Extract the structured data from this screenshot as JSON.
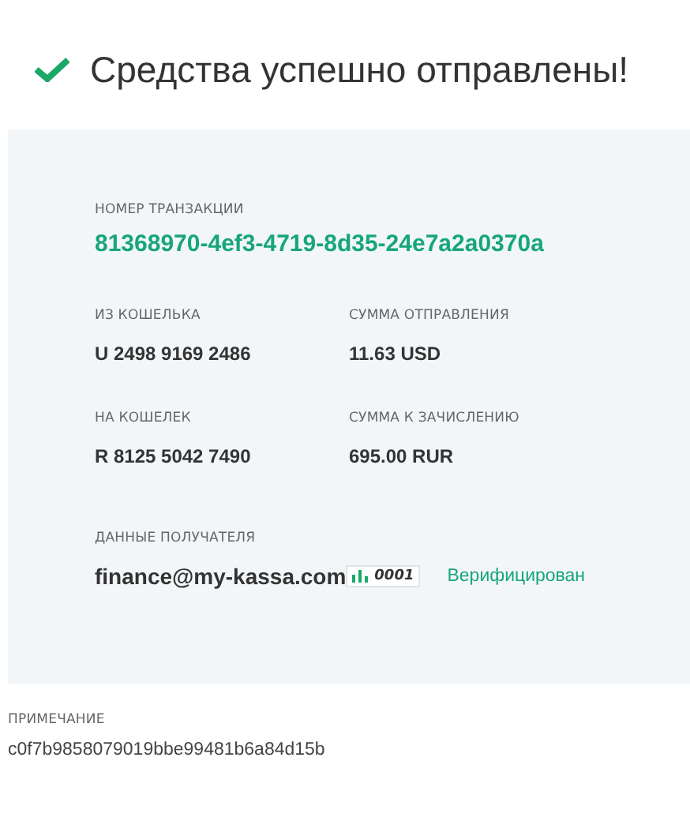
{
  "title": "Средства успешно отправлены!",
  "transaction": {
    "label": "НОМЕР ТРАНЗАКЦИИ",
    "value": "81368970-4ef3-4719-8d35-24e7a2a0370a"
  },
  "fields": [
    {
      "label": "ИЗ КОШЕЛЬКА",
      "value": "U 2498 9169 2486"
    },
    {
      "label": "СУММА ОТПРАВЛЕНИЯ",
      "value": "11.63 USD"
    },
    {
      "label": "НА КОШЕЛЕК",
      "value": "R 8125 5042 7490"
    },
    {
      "label": "СУММА К ЗАЧИСЛЕНИЮ",
      "value": "695.00 RUR"
    }
  ],
  "recipient": {
    "label": "ДАННЫЕ ПОЛУЧАТЕЛЯ",
    "email": "finance@my-kassa.com",
    "badge": "0001",
    "status": "Верифицирован"
  },
  "note": {
    "label": "ПРИМЕЧАНИЕ",
    "value": "c0f7b9858079019bbe99481b6a84d15b"
  }
}
